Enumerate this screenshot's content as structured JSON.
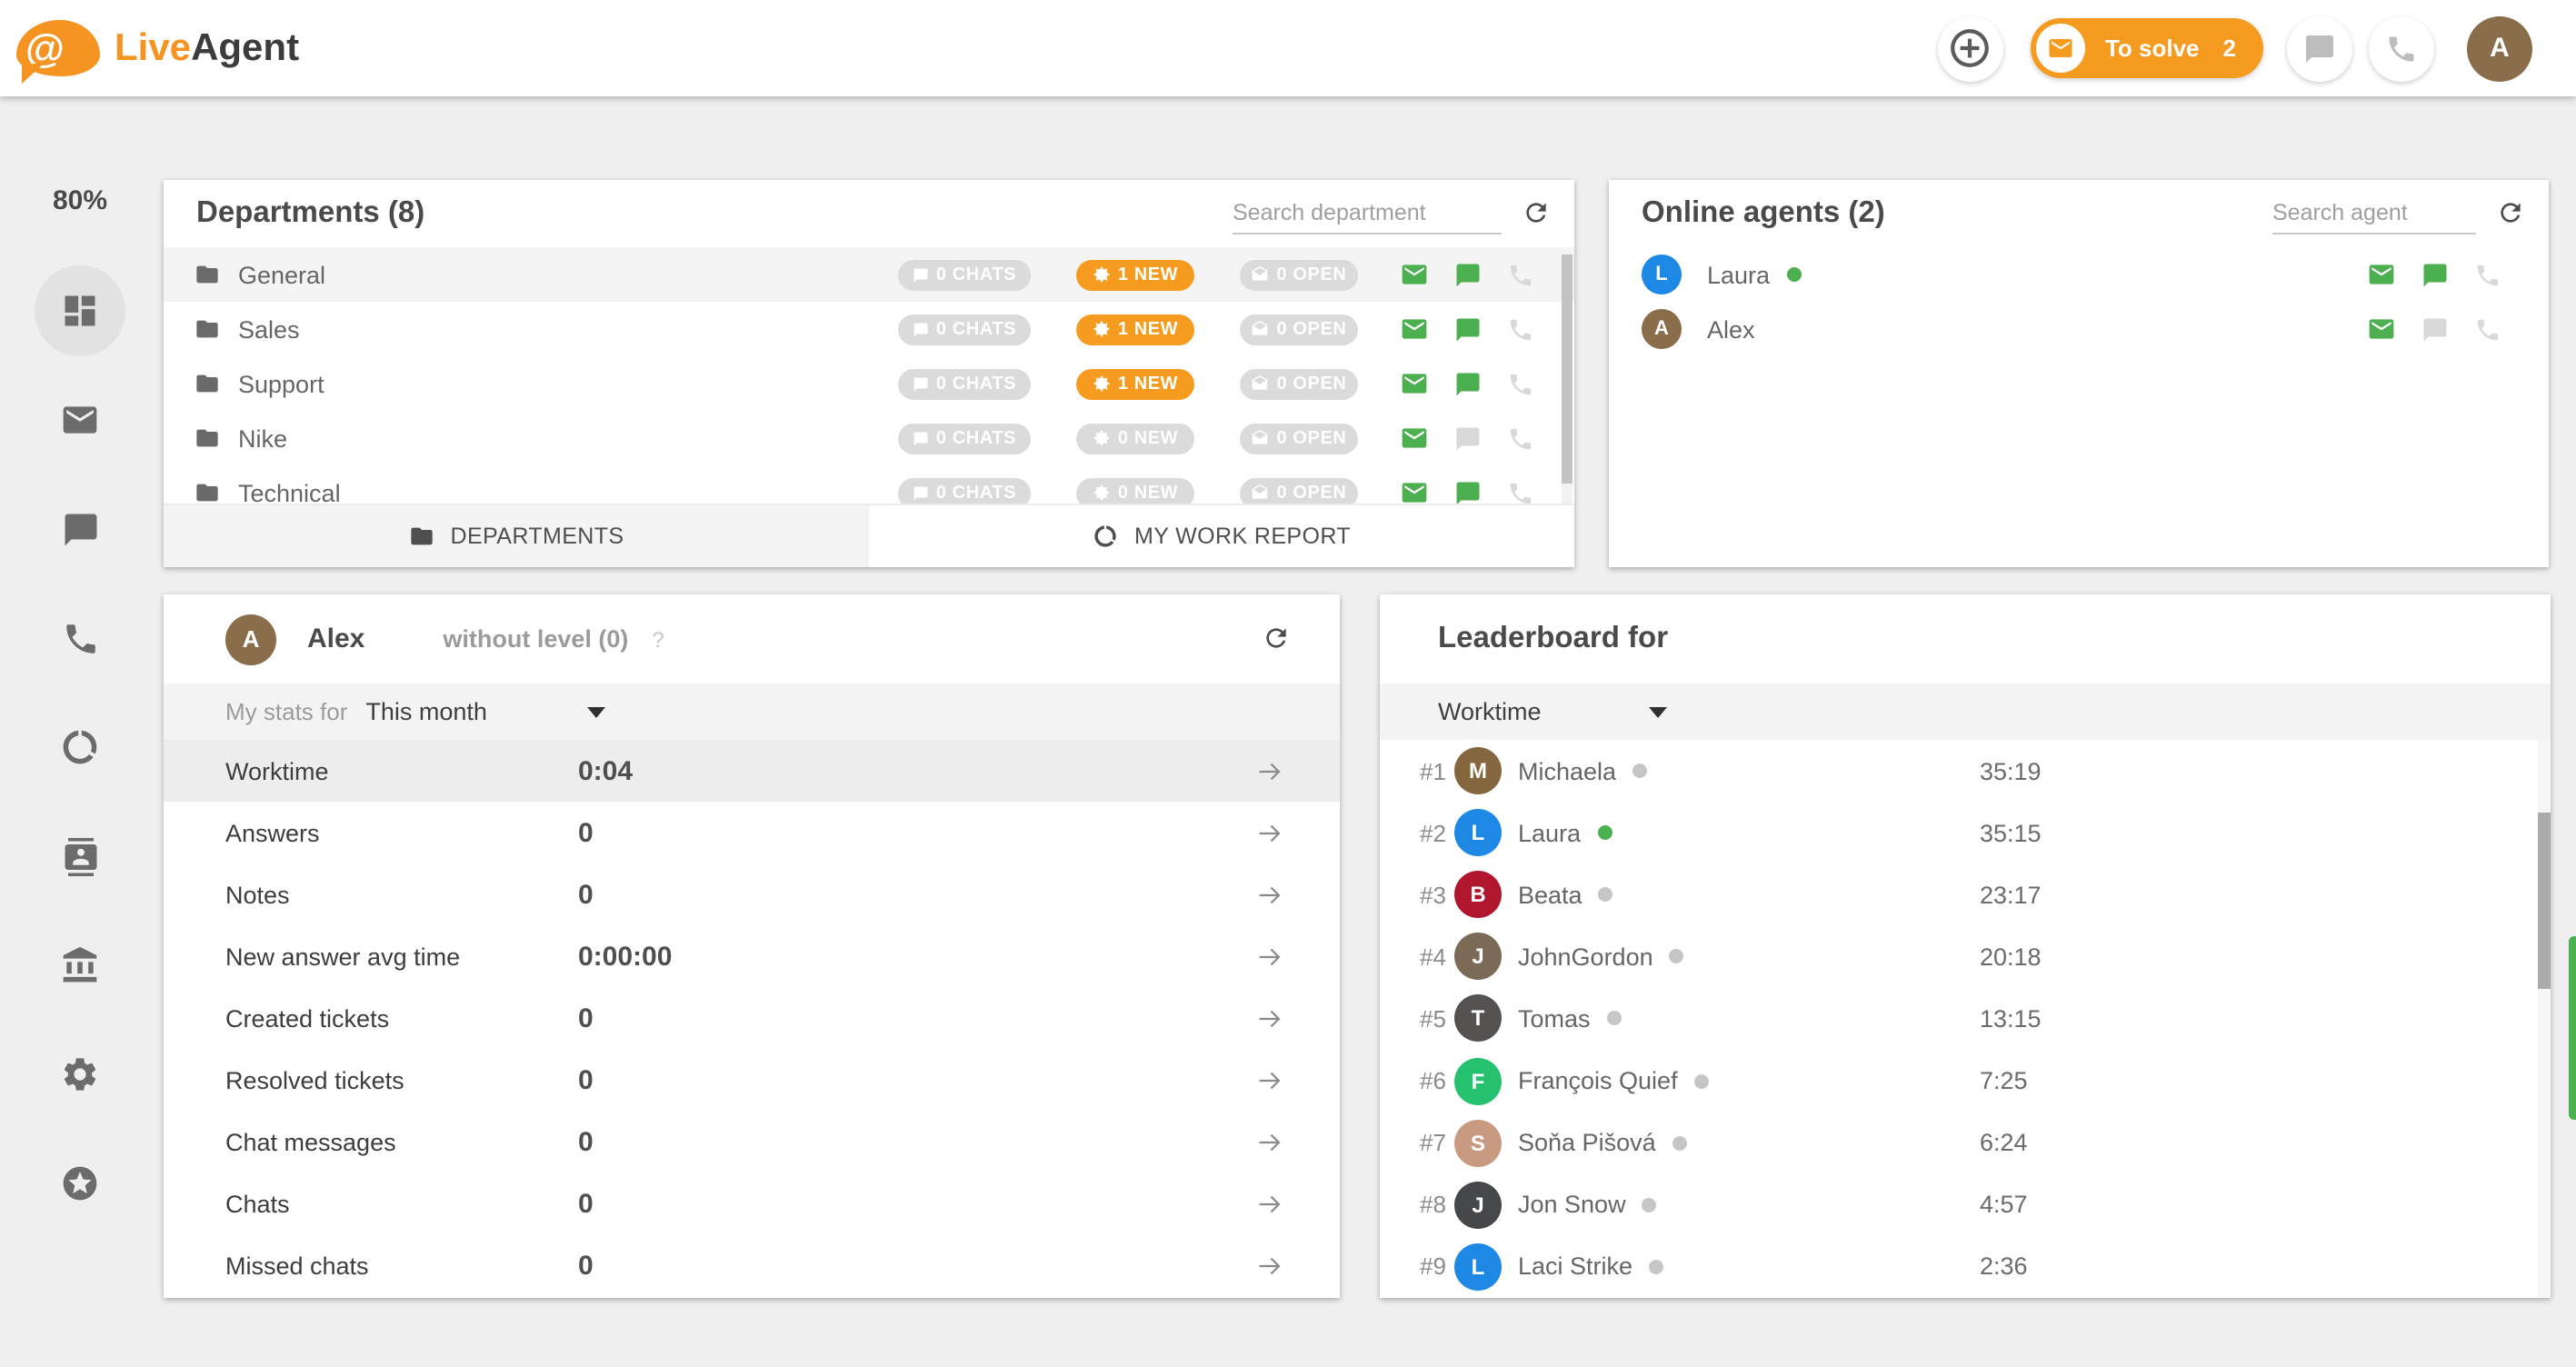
{
  "header": {
    "logo_live": "Live",
    "logo_agent": "Agent",
    "logo_at": "@",
    "to_solve": {
      "label": "To solve",
      "count": "2"
    },
    "avatar_initial": "A"
  },
  "sidebar": {
    "utilization": "80%",
    "items": [
      {
        "icon": "dashboard-icon",
        "active": true
      },
      {
        "icon": "mail-icon",
        "active": false
      },
      {
        "icon": "chat-icon",
        "active": false
      },
      {
        "icon": "phone-icon",
        "active": false
      },
      {
        "icon": "data-usage-icon",
        "active": false
      },
      {
        "icon": "contacts-icon",
        "active": false
      },
      {
        "icon": "bank-icon",
        "active": false
      },
      {
        "icon": "gear-icon",
        "active": false
      },
      {
        "icon": "star-circle-icon",
        "active": false
      }
    ]
  },
  "departments": {
    "title": "Departments (8)",
    "search_placeholder": "Search department",
    "rows": [
      {
        "name": "General",
        "chats_label": "0 CHATS",
        "new_label": "1 NEW",
        "new_active": true,
        "open_label": "0 OPEN",
        "mail_active": true,
        "chat_active": true,
        "highlight": true
      },
      {
        "name": "Sales",
        "chats_label": "0 CHATS",
        "new_label": "1 NEW",
        "new_active": true,
        "open_label": "0 OPEN",
        "mail_active": true,
        "chat_active": true,
        "highlight": false
      },
      {
        "name": "Support",
        "chats_label": "0 CHATS",
        "new_label": "1 NEW",
        "new_active": true,
        "open_label": "0 OPEN",
        "mail_active": true,
        "chat_active": true,
        "highlight": false
      },
      {
        "name": "Nike",
        "chats_label": "0 CHATS",
        "new_label": "0 NEW",
        "new_active": false,
        "open_label": "0 OPEN",
        "mail_active": true,
        "chat_active": false,
        "highlight": false
      },
      {
        "name": "Technical",
        "chats_label": "0 CHATS",
        "new_label": "0 NEW",
        "new_active": false,
        "open_label": "0 OPEN",
        "mail_active": true,
        "chat_active": true,
        "highlight": false
      }
    ],
    "tabs": [
      {
        "label": "DEPARTMENTS"
      },
      {
        "label": "MY WORK REPORT"
      }
    ]
  },
  "online_agents": {
    "title": "Online agents (2)",
    "search_placeholder": "Search agent",
    "rows": [
      {
        "initial": "L",
        "name": "Laura",
        "avatar_color": "#1e88e5",
        "online": true,
        "mail_active": true,
        "chat_active": true
      },
      {
        "initial": "A",
        "name": "Alex",
        "avatar_color": "#8a6d4a",
        "online": false,
        "mail_active": true,
        "chat_active": false
      }
    ]
  },
  "my_stats": {
    "agent_initial": "A",
    "agent_name": "Alex",
    "level": "without level (0)",
    "help": "?",
    "filter_label": "My stats for",
    "filter_value": "This month",
    "rows": [
      {
        "label": "Worktime",
        "value": "0:04",
        "highlight": true
      },
      {
        "label": "Answers",
        "value": "0",
        "highlight": false
      },
      {
        "label": "Notes",
        "value": "0",
        "highlight": false
      },
      {
        "label": "New answer avg time",
        "value": "0:00:00",
        "highlight": false
      },
      {
        "label": "Created tickets",
        "value": "0",
        "highlight": false
      },
      {
        "label": "Resolved tickets",
        "value": "0",
        "highlight": false
      },
      {
        "label": "Chat messages",
        "value": "0",
        "highlight": false
      },
      {
        "label": "Chats",
        "value": "0",
        "highlight": false
      },
      {
        "label": "Missed chats",
        "value": "0",
        "highlight": false
      }
    ]
  },
  "leaderboard": {
    "title": "Leaderboard for",
    "filter_value": "Worktime",
    "rows": [
      {
        "rank": "#1",
        "initial": "M",
        "name": "Michaela",
        "time": "35:19",
        "avatar_color": "#84663f",
        "photo": false,
        "online": false
      },
      {
        "rank": "#2",
        "initial": "L",
        "name": "Laura",
        "time": "35:15",
        "avatar_color": "#1e88e5",
        "photo": false,
        "online": true
      },
      {
        "rank": "#3",
        "initial": "B",
        "name": "Beata",
        "time": "23:17",
        "avatar_color": "#b0172f",
        "photo": false,
        "online": false
      },
      {
        "rank": "#4",
        "initial": "J",
        "name": "JohnGordon",
        "time": "20:18",
        "avatar_color": "#7b6a55",
        "photo": true,
        "online": false
      },
      {
        "rank": "#5",
        "initial": "T",
        "name": "Tomas",
        "time": "13:15",
        "avatar_color": "#555150",
        "photo": true,
        "online": false
      },
      {
        "rank": "#6",
        "initial": "F",
        "name": "François Quief",
        "time": "7:25",
        "avatar_color": "#25c16f",
        "photo": false,
        "online": false
      },
      {
        "rank": "#7",
        "initial": "S",
        "name": "Soňa Pišová",
        "time": "6:24",
        "avatar_color": "#c99a82",
        "photo": true,
        "online": false
      },
      {
        "rank": "#8",
        "initial": "J",
        "name": "Jon Snow",
        "time": "4:57",
        "avatar_color": "#46474b",
        "photo": true,
        "online": false
      },
      {
        "rank": "#9",
        "initial": "L",
        "name": "Laci Strike",
        "time": "2:36",
        "avatar_color": "#1e88e5",
        "photo": false,
        "online": false
      }
    ]
  },
  "colors": {
    "accent_orange": "#f59c20",
    "action_green": "#4caf50",
    "badge_gray": "#dbdbdb"
  }
}
